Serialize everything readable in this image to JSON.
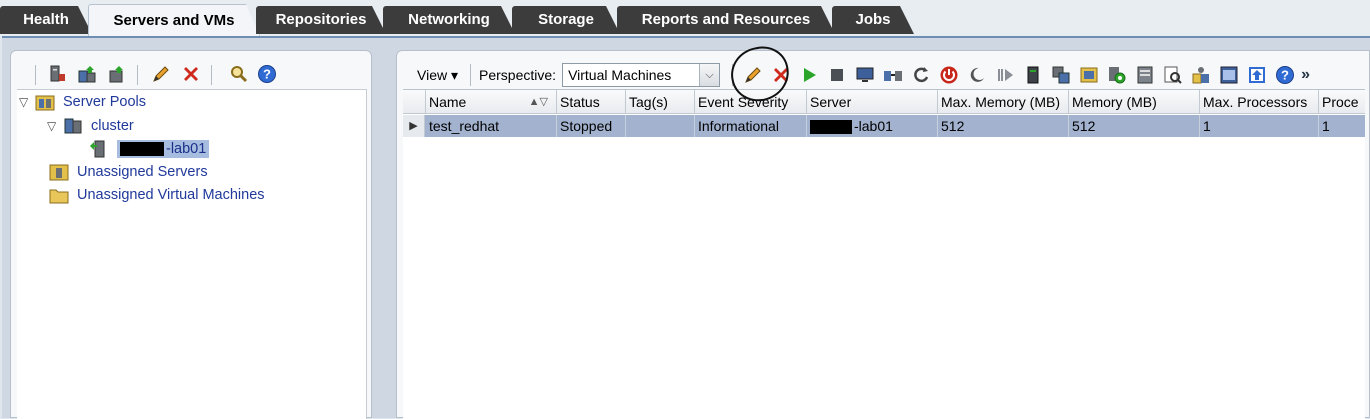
{
  "tabs": [
    {
      "label": "Health"
    },
    {
      "label": "Servers and VMs"
    },
    {
      "label": "Repositories"
    },
    {
      "label": "Networking"
    },
    {
      "label": "Storage"
    },
    {
      "label": "Reports and Resources"
    },
    {
      "label": "Jobs"
    }
  ],
  "tree": {
    "server_pools": "Server Pools",
    "cluster": "cluster",
    "server_suffix": "-lab01",
    "unassigned_servers": "Unassigned Servers",
    "unassigned_vms": "Unassigned Virtual Machines"
  },
  "toolbar": {
    "view_label": "View ▾",
    "perspective_label": "Perspective:",
    "perspective_value": "Virtual Machines",
    "overflow": "»"
  },
  "table": {
    "columns": [
      "Name",
      "Status",
      "Tag(s)",
      "Event Severity",
      "Server",
      "Max. Memory (MB)",
      "Memory (MB)",
      "Max. Processors",
      "Proce"
    ],
    "rows": [
      {
        "name": "test_redhat",
        "status": "Stopped",
        "tags": "",
        "event_severity": "Informational",
        "server_suffix": "-lab01",
        "max_memory": "512",
        "memory": "512",
        "max_processors": "1",
        "processors": "1"
      }
    ]
  },
  "colors": {
    "selection": "#a2b2cf",
    "tab_dark": "#3c3c3c",
    "link": "#20399a"
  }
}
